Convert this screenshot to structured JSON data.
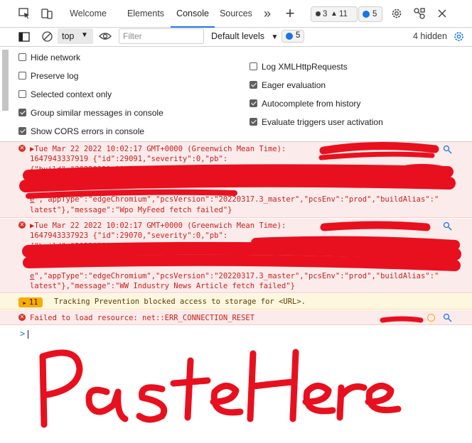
{
  "tabbar": {
    "tabs": [
      {
        "label": "Welcome"
      },
      {
        "label": "Elements"
      },
      {
        "label": "Console"
      },
      {
        "label": "Sources"
      }
    ],
    "more_label": "»",
    "add_label": "+",
    "errors_count": "3",
    "warnings_count": "11",
    "issues_count": "5"
  },
  "toolbar": {
    "context": "top",
    "filter_placeholder": "Filter",
    "levels": "Default levels",
    "issues_count": "5",
    "hidden": "4 hidden"
  },
  "settings": {
    "left": [
      {
        "label": "Hide network",
        "checked": false
      },
      {
        "label": "Preserve log",
        "checked": false
      },
      {
        "label": "Selected context only",
        "checked": false
      },
      {
        "label": "Group similar messages in console",
        "checked": true
      },
      {
        "label": "Show CORS errors in console",
        "checked": true
      }
    ],
    "right": [
      {
        "label": "Log XMLHttpRequests",
        "checked": false
      },
      {
        "label": "Eager evaluation",
        "checked": true
      },
      {
        "label": "Autocomplete from history",
        "checked": true
      },
      {
        "label": "Evaluate triggers user activation",
        "checked": true
      }
    ]
  },
  "messages": {
    "m1": {
      "l1": "▶Tue Mar 22 2022 10:02:17 GMT+0000 (Greenwich Mean Time):",
      "l2": "1647943337919 {\"id\":29091,\"severity\":0,\"pb\":",
      "l3": "{\"build\":\"20220321.380\",\"customMessage\":\"Error: TypeError: Failed to fetch. Url:",
      "l4_link": "e",
      "l4": "\",\"appType\":\"edgeChromium\",\"pcsVersion\":\"20220317.3_master\",\"pcsEnv\":\"prod\",\"buildAlias\":\"",
      "l5": "latest\"},\"message\":\"Wpo MyFeed fetch failed\"}"
    },
    "m2": {
      "l1": "▶Tue Mar 22 2022 10:02:17 GMT+0000 (Greenwich Mean Time):",
      "l2": "1647943337923 {\"id\":29070,\"severity\":0,\"pb\":",
      "l3": "{\"build\":\"20220321.380\",\"customMessage\":{},\"url\":\"",
      "l4_link": "e",
      "l4": "\",\"appType\":\"edgeChromium\",\"pcsVersion\":\"20220317.3_master\",\"pcsEnv\":\"prod\",\"buildAlias\":\"",
      "l5": "latest\"},\"message\":\"WW Industry News Article fetch failed\"}"
    },
    "warn": {
      "count": "11",
      "text": "Tracking Prevention blocked access to storage for <URL>."
    },
    "err3": {
      "text": "Failed to load resource: net::ERR_CONNECTION_RESET"
    }
  },
  "prompt_symbol": ">",
  "colors": {
    "accent": "#1a73e8",
    "error": "#c5221f",
    "error_bg": "#fcebeb",
    "warning": "#f9ab00",
    "scribble": "#e8101e"
  }
}
